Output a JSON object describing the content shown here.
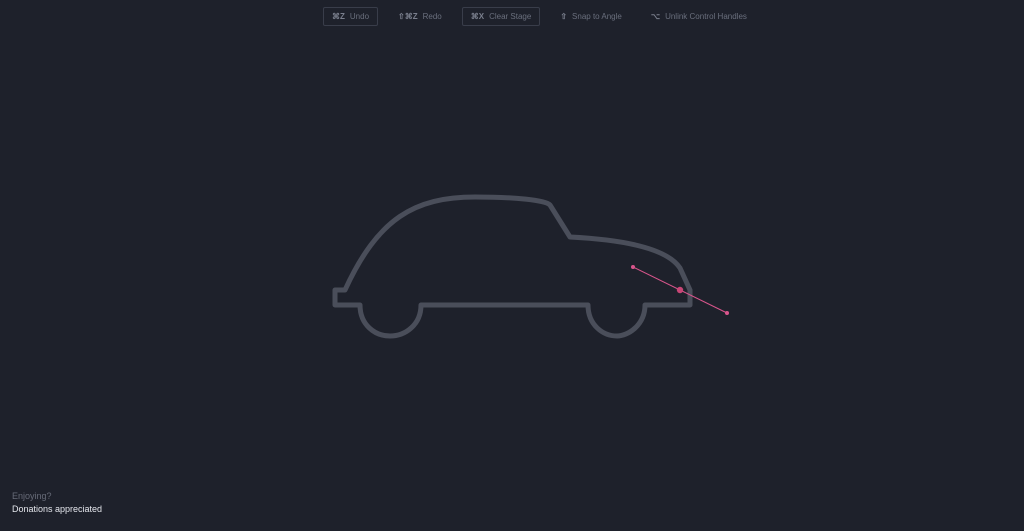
{
  "toolbar": {
    "items": [
      {
        "key": "⌘Z",
        "label": "Undo"
      },
      {
        "key": "⇧⌘Z",
        "label": "Redo"
      },
      {
        "key": "⌘X",
        "label": "Clear Stage"
      },
      {
        "key": "⇧",
        "label": "Snap to Angle"
      },
      {
        "key": "⌥",
        "label": "Unlink Control Handles"
      }
    ]
  },
  "footer": {
    "prompt": "Enjoying?",
    "link": "Donations appreciated"
  },
  "colors": {
    "background": "#1e212b",
    "path_stroke": "#4a4e5a",
    "handle_line": "#d9558c",
    "anchor_point": "#c84676"
  }
}
